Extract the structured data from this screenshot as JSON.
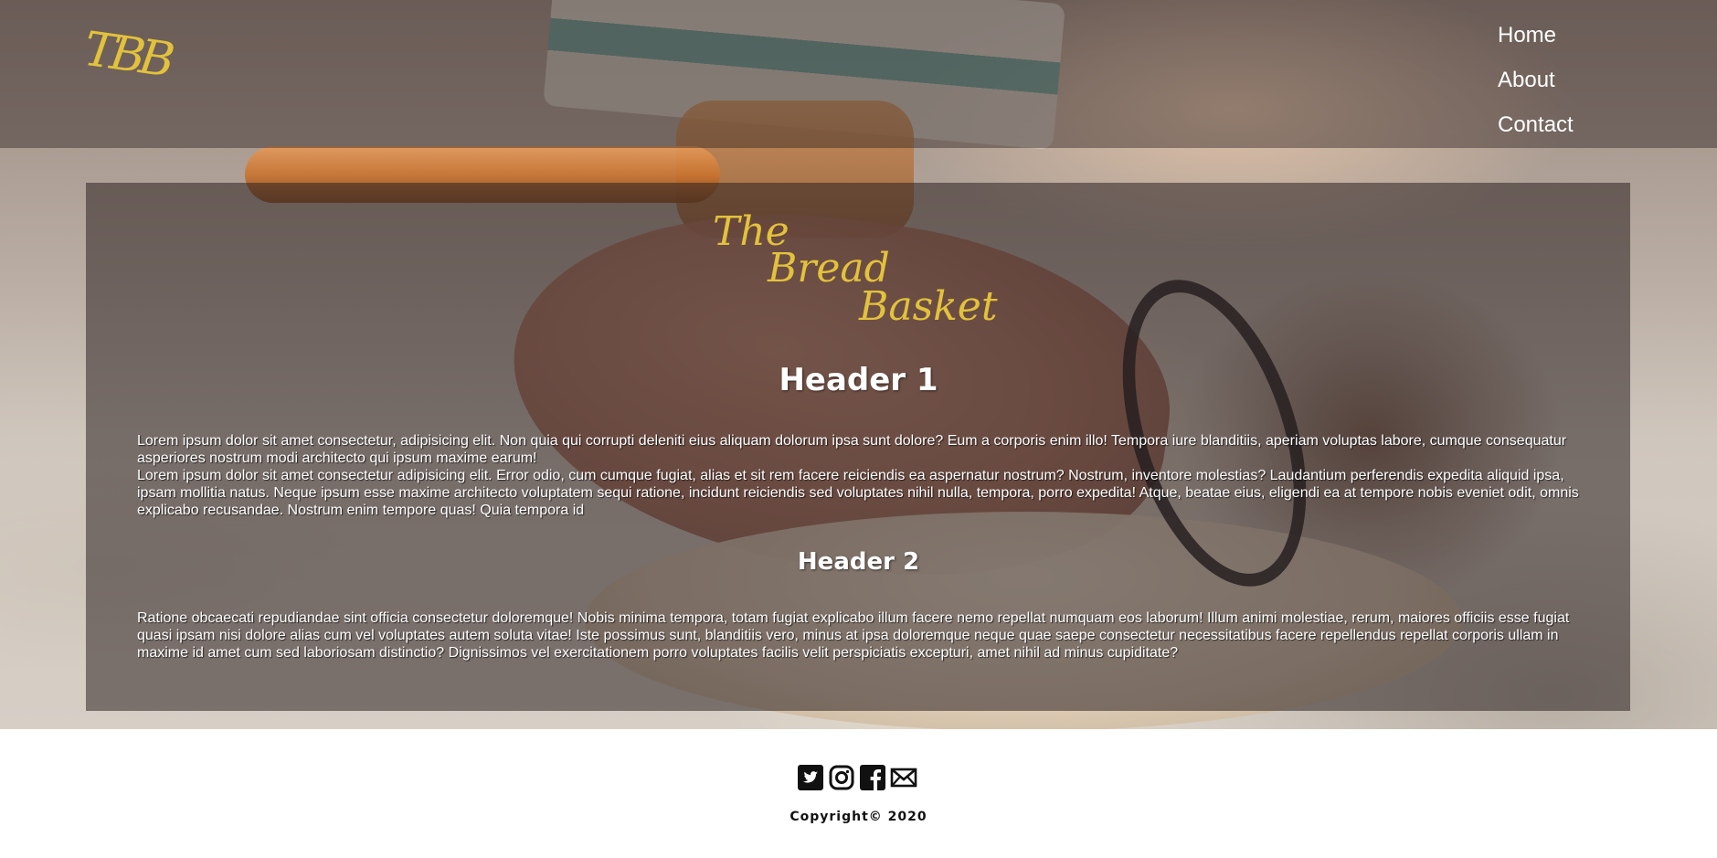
{
  "site": {
    "logo_text": "TBB",
    "brand_words": [
      "The",
      "Bread",
      "Basket"
    ]
  },
  "nav": {
    "items": [
      "Home",
      "About",
      "Contact"
    ]
  },
  "content": {
    "header1": "Header 1",
    "paragraph1": "Lorem ipsum dolor sit amet consectetur, adipisicing elit. Non quia qui corrupti deleniti eius aliquam dolorum ipsa sunt dolore? Eum a corporis enim illo! Tempora iure blanditiis, aperiam voluptas labore, cumque consequatur asperiores nostrum modi architecto qui ipsum maxime earum!",
    "paragraph2": "Lorem ipsum dolor sit amet consectetur adipisicing elit. Error odio, cum cumque fugiat, alias et sit rem facere reiciendis ea aspernatur nostrum? Nostrum, inventore molestias? Laudantium perferendis expedita aliquid ipsa, ipsam mollitia natus. Neque ipsum esse maxime architecto voluptatem sequi ratione, incidunt reiciendis sed voluptates nihil nulla, tempora, porro expedita! Atque, beatae eius, eligendi ea at tempore nobis eveniet odit, omnis explicabo recusandae. Nostrum enim tempore quas! Quia tempora id",
    "header2": "Header 2",
    "paragraph3": "Ratione obcaecati repudiandae sint officia consectetur doloremque! Nobis minima tempora, totam fugiat explicabo illum facere nemo repellat numquam eos laborum! Illum animi molestiae, rerum, maiores officiis esse fugiat quasi ipsam nisi dolore alias cum vel voluptates autem soluta vitae! Iste possimus sunt, blanditiis vero, minus at ipsa doloremque neque quae saepe consectetur necessitatibus facere repellendus repellat corporis ullam in maxime id amet cum sed laboriosam distinctio? Dignissimos vel exercitationem porro voluptates facilis velit perspiciatis excepturi, amet nihil ad minus cupiditate?"
  },
  "footer": {
    "socials": [
      "twitter-icon",
      "instagram-icon",
      "facebook-icon",
      "mail-icon"
    ],
    "copyright": "Copyright© 2020"
  },
  "colors": {
    "accent": "#e2c23c",
    "text_light": "#ffffff",
    "footer_text": "#111111"
  }
}
